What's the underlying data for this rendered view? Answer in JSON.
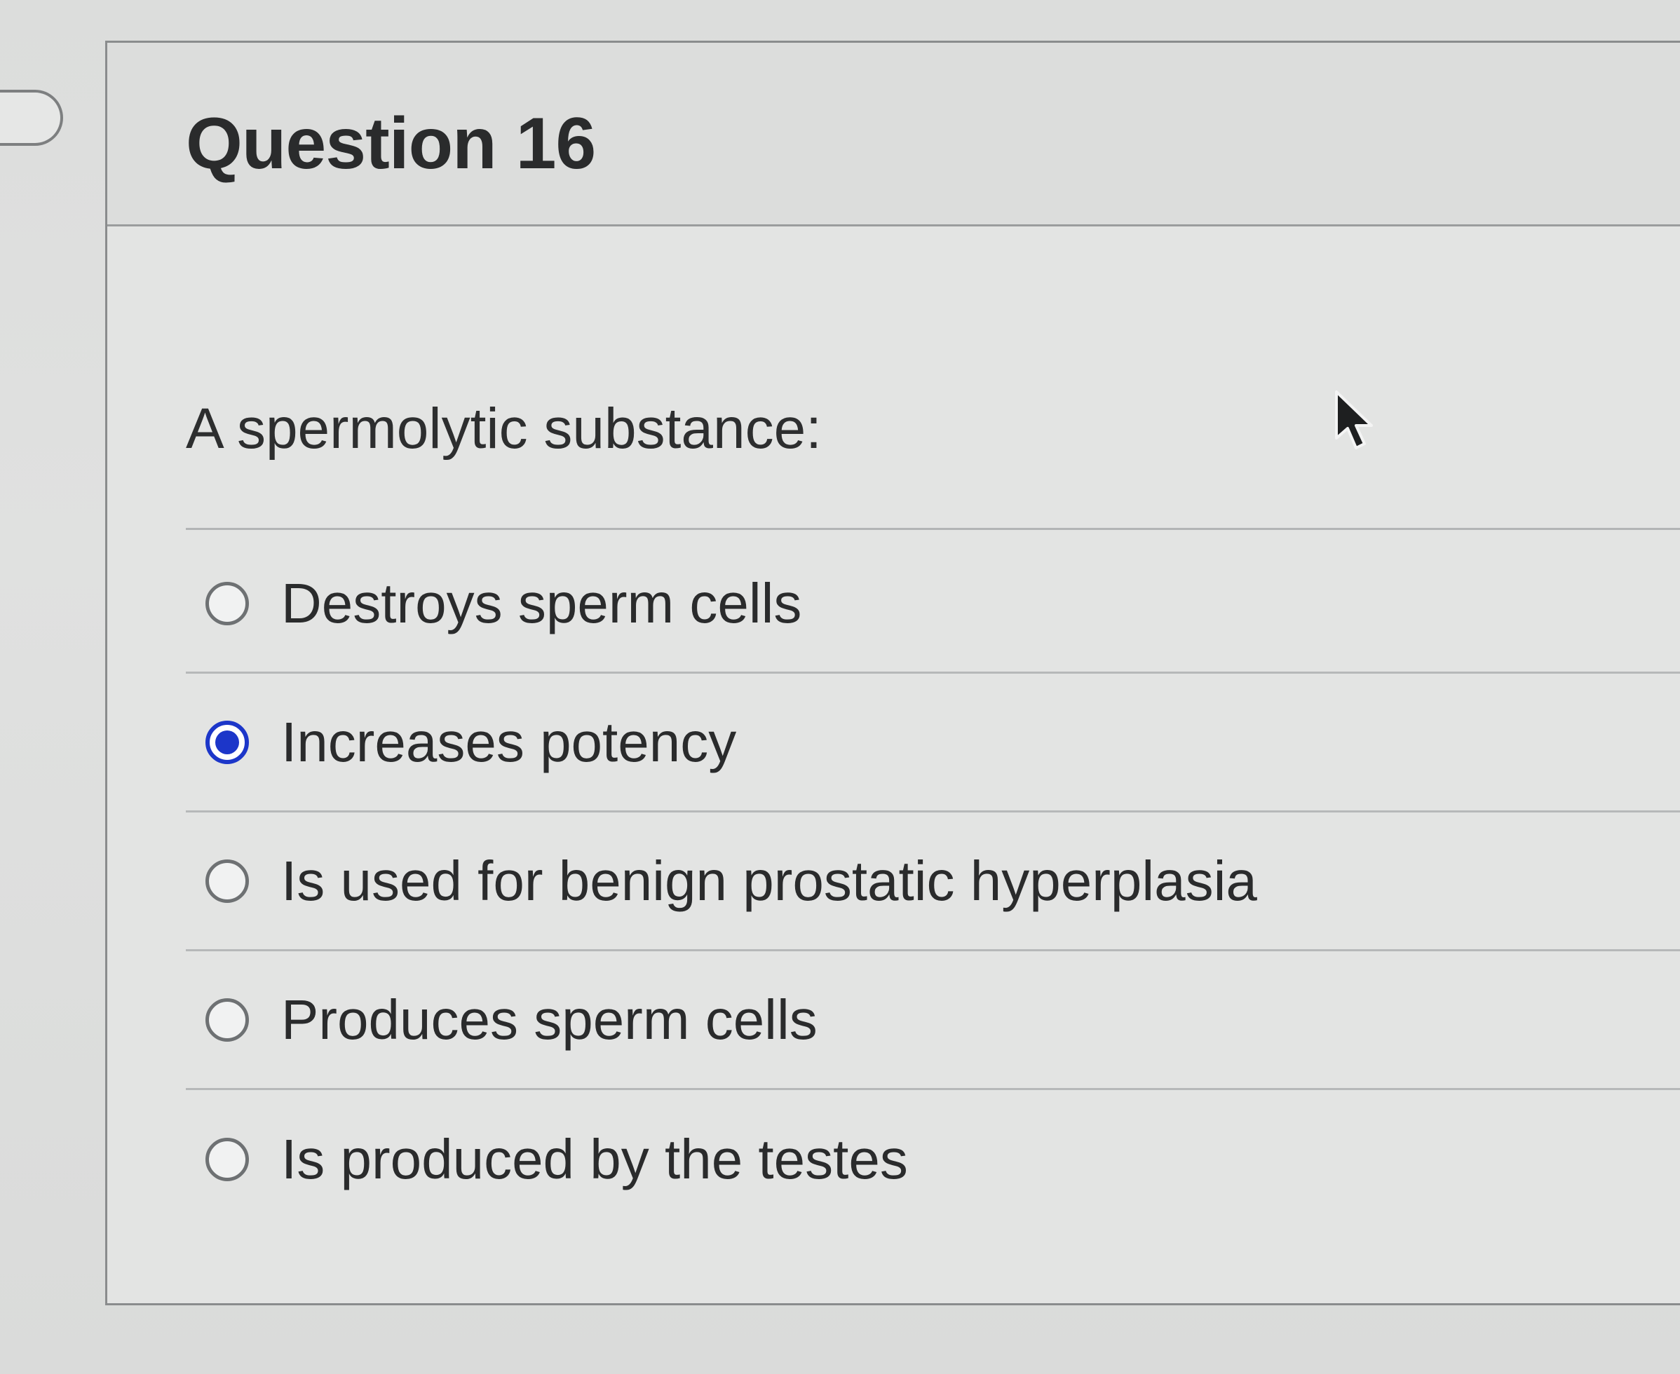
{
  "question": {
    "title": "Question 16",
    "prompt": "A spermolytic substance:"
  },
  "options": [
    {
      "label": "Destroys sperm cells",
      "selected": false
    },
    {
      "label": "Increases potency",
      "selected": true
    },
    {
      "label": "Is used for benign prostatic hyperplasia",
      "selected": false
    },
    {
      "label": "Produces sperm cells",
      "selected": false
    },
    {
      "label": "Is produced by the testes",
      "selected": false
    }
  ],
  "colors": {
    "selected_radio": "#1c36c9",
    "text": "#2a2b2c"
  }
}
